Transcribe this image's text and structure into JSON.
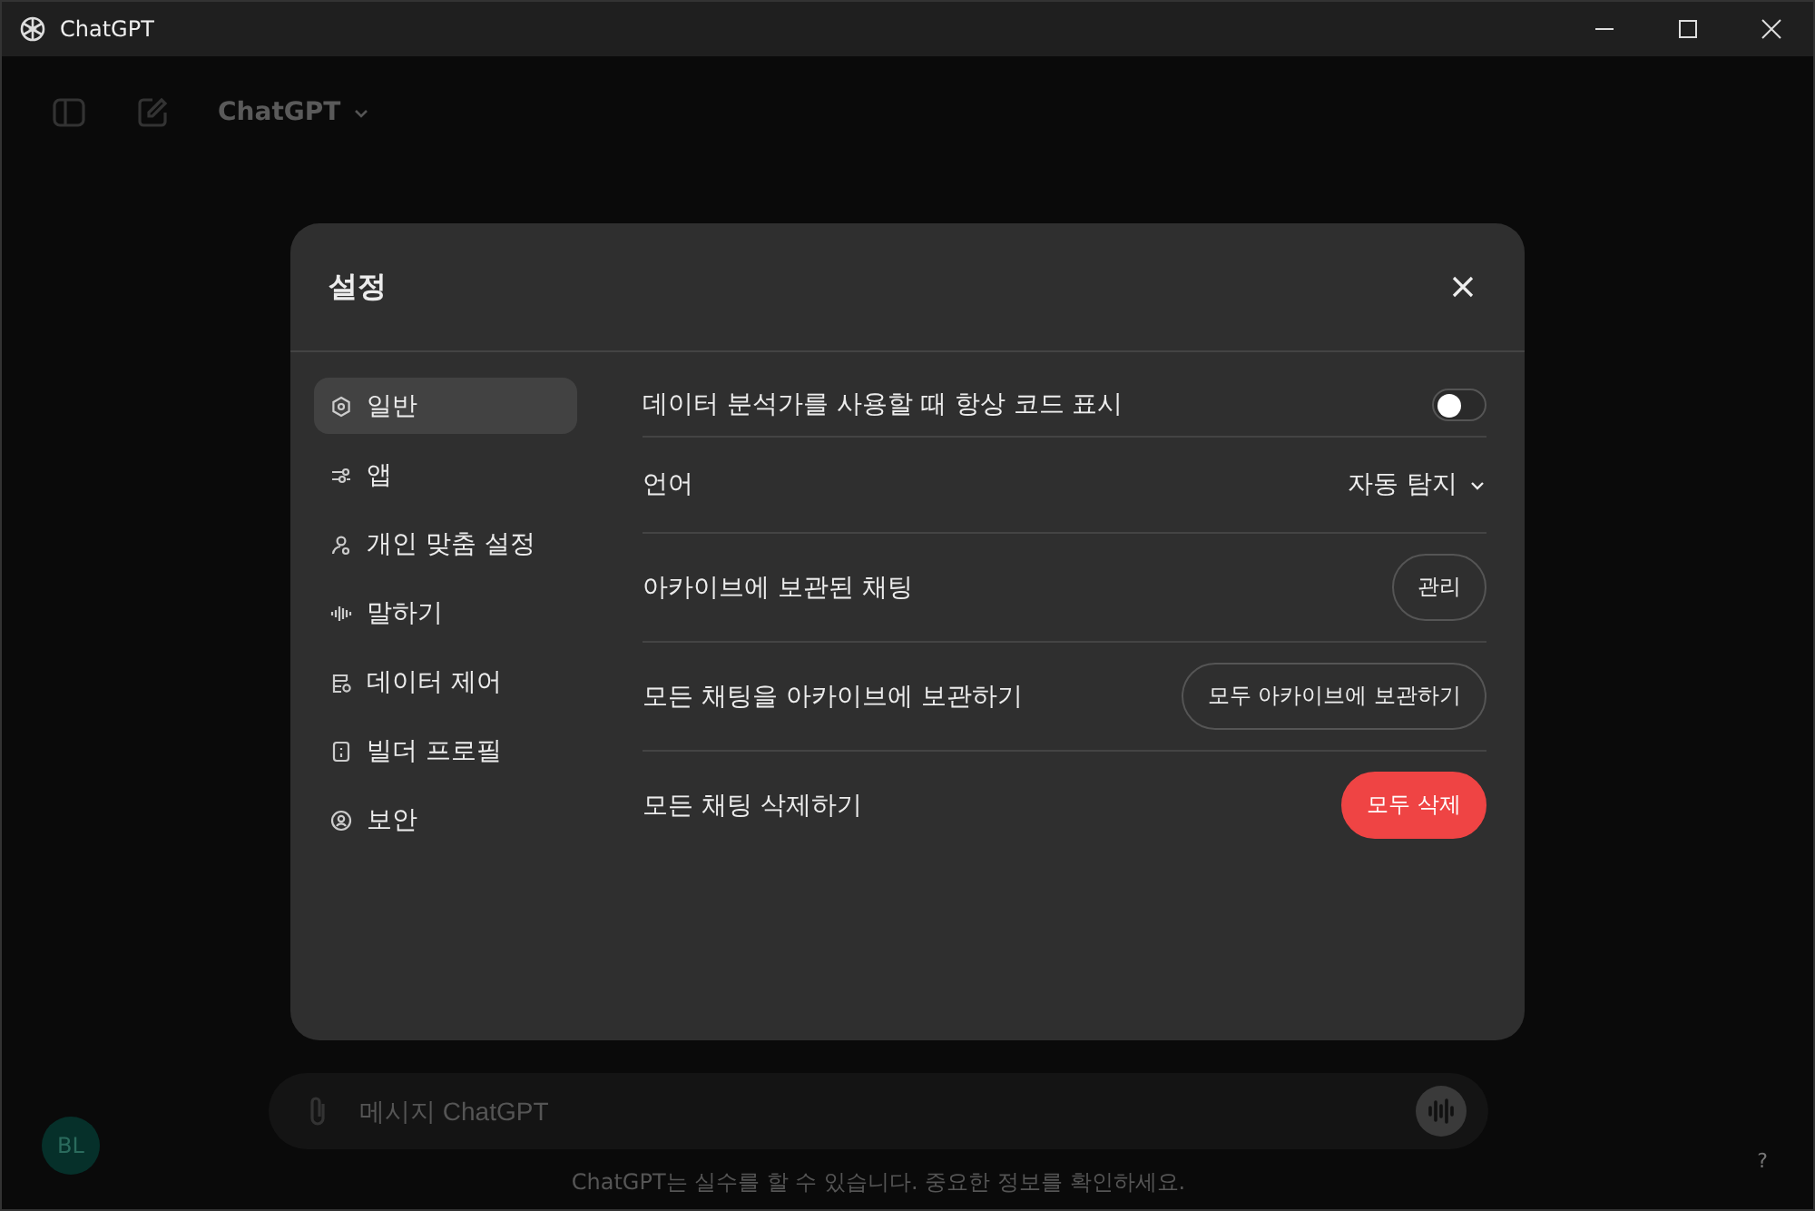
{
  "window": {
    "title": "ChatGPT"
  },
  "toolbar": {
    "model": "ChatGPT"
  },
  "dialog": {
    "title": "설정",
    "sidebar": {
      "items": [
        {
          "label": "일반",
          "selected": true
        },
        {
          "label": "앱",
          "selected": false
        },
        {
          "label": "개인 맞춤 설정",
          "selected": false
        },
        {
          "label": "말하기",
          "selected": false
        },
        {
          "label": "데이터 제어",
          "selected": false
        },
        {
          "label": "빌더 프로필",
          "selected": false
        },
        {
          "label": "보안",
          "selected": false
        }
      ]
    },
    "settings": [
      {
        "kind": "toggle",
        "label": "데이터 분석가를 사용할 때 항상 코드 표시",
        "on": false
      },
      {
        "kind": "dropdown",
        "label": "언어",
        "value": "자동 탐지"
      },
      {
        "kind": "button",
        "label": "아카이브에 보관된 채팅",
        "button": "관리",
        "danger": false
      },
      {
        "kind": "button",
        "label": "모든 채팅을 아카이브에 보관하기",
        "button": "모두 아카이브에 보관하기",
        "danger": false
      },
      {
        "kind": "button",
        "label": "모든 채팅 삭제하기",
        "button": "모두 삭제",
        "danger": true
      }
    ]
  },
  "avatar": "BL",
  "composer": {
    "placeholder": "메시지 ChatGPT"
  },
  "disclaimer": "ChatGPT는 실수를 할 수 있습니다. 중요한 정보를 확인하세요.",
  "help": "?"
}
